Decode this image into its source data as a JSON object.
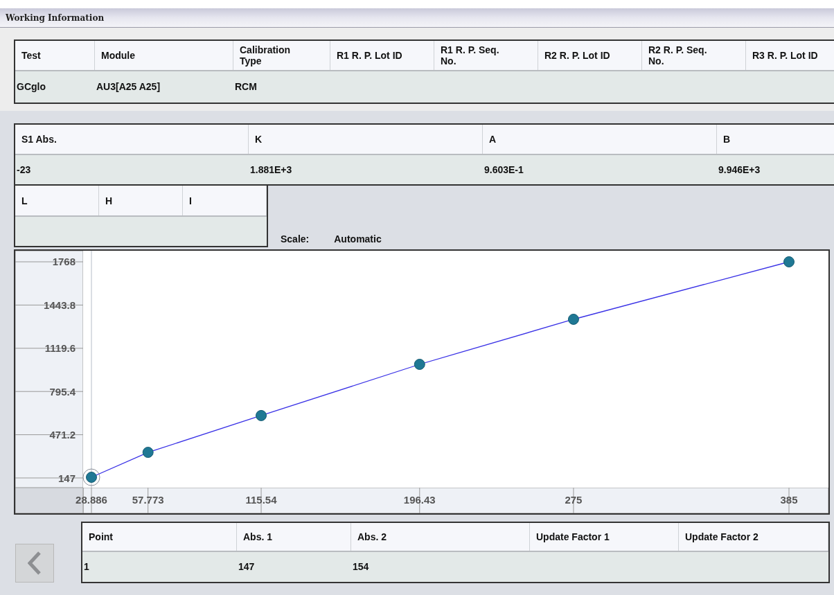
{
  "window": {
    "title": "Working Information"
  },
  "test_table": {
    "columns": [
      {
        "label": "Test"
      },
      {
        "label": "Module"
      },
      {
        "label": "Calibration Type"
      },
      {
        "label": "R1 R. P. Lot ID"
      },
      {
        "label": "R1 R. P. Seq. No."
      },
      {
        "label": "R2 R. P. Lot ID"
      },
      {
        "label": "R2 R. P. Seq. No."
      },
      {
        "label": "R3 R. P. Lot ID"
      }
    ],
    "rows": [
      [
        "GCglo",
        "AU3[A25 A25]",
        "RCM"
      ]
    ]
  },
  "factor_table": {
    "columns": [
      {
        "label": "S1 Abs."
      },
      {
        "label": "K"
      },
      {
        "label": "A"
      },
      {
        "label": "B"
      }
    ],
    "rows": [
      [
        "-23",
        "1.881E+3",
        "9.603E-1",
        "9.946E+3"
      ]
    ]
  },
  "limit_table": {
    "columns": [
      {
        "label": "L"
      },
      {
        "label": "H"
      },
      {
        "label": "I"
      }
    ]
  },
  "scale": {
    "label": "Scale:",
    "value": "Automatic"
  },
  "chart": {
    "chart_data": {
      "type": "line",
      "x": [
        28.886,
        57.773,
        115.54,
        196.43,
        275,
        385
      ],
      "series": [
        {
          "color": "#3a32e6",
          "marker": "circle",
          "values": [
            152,
            339,
            615,
            999,
            1337,
            1768
          ]
        }
      ],
      "xlim": [
        28.886,
        385
      ],
      "ylim": [
        74.3,
        1851.1
      ],
      "xticks": [
        {
          "value": 28.886,
          "label": "28.886"
        },
        {
          "value": 57.773,
          "label": "57.773"
        },
        {
          "value": 115.54,
          "label": "115.54"
        },
        {
          "value": 196.43,
          "label": "196.43"
        },
        {
          "value": 275,
          "label": "275"
        },
        {
          "value": 385,
          "label": "385"
        }
      ],
      "yticks": [
        {
          "value": 147,
          "label": "147"
        },
        {
          "value": 471.2,
          "label": "471.2"
        },
        {
          "value": 795.4,
          "label": "795.4"
        },
        {
          "value": 1119.6,
          "label": "1119.6"
        },
        {
          "value": 1443.8,
          "label": "1443.8"
        },
        {
          "value": 1768,
          "label": "1768"
        }
      ]
    }
  },
  "point_table": {
    "columns": [
      {
        "label": "Point"
      },
      {
        "label": "Abs. 1"
      },
      {
        "label": "Abs. 2"
      },
      {
        "label": "Update Factor 1"
      },
      {
        "label": "Update Factor 2"
      }
    ],
    "rows": [
      {
        "cells": [
          "1",
          "147",
          "154"
        ],
        "selected": true
      }
    ]
  },
  "back_button": {
    "disabled": true
  }
}
